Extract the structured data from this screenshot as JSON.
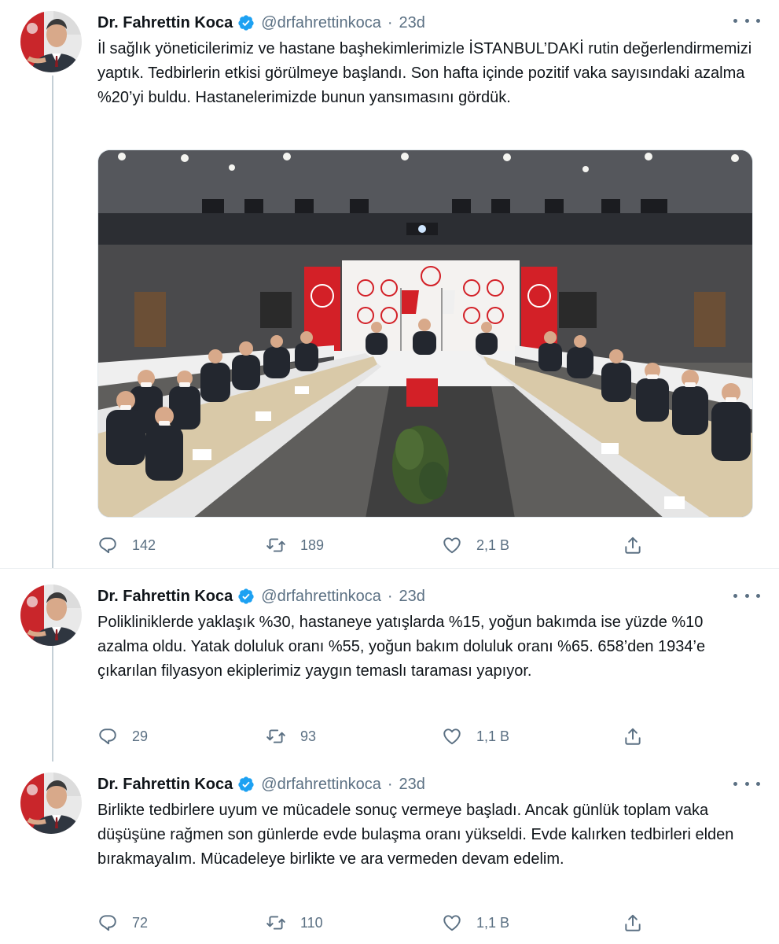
{
  "tweets": [
    {
      "name": "Dr. Fahrettin Koca",
      "handle": "@drfahrettinkoca",
      "separator": "·",
      "time": "23d",
      "text": "İl sağlık yöneticilerimiz ve hastane başhekimlerimizle İSTANBUL’DAKİ rutin değerlendirmemizi yaptık. Tedbirlerin etkisi görülmeye başlandı. Son hafta içinde pozitif vaka sayısındaki azalma %20’yi buldu. Hastanelerimizde bunun yansımasını gördük.",
      "replies": "142",
      "retweets": "189",
      "likes": "2,1 B"
    },
    {
      "name": "Dr. Fahrettin Koca",
      "handle": "@drfahrettinkoca",
      "separator": "·",
      "time": "23d",
      "text": "Polikliniklerde yaklaşık %30, hastaneye yatışlarda %15, yoğun bakımda ise yüzde %10 azalma oldu. Yatak doluluk oranı %55, yoğun bakım doluluk oranı %65. 658’den 1934’e çıkarılan filyasyon ekiplerimiz yaygın temaslı taraması yapıyor.",
      "replies": "29",
      "retweets": "93",
      "likes": "1,1 B"
    },
    {
      "name": "Dr. Fahrettin Koca",
      "handle": "@drfahrettinkoca",
      "separator": "·",
      "time": "23d",
      "text": "Birlikte tedbirlere uyum ve mücadele sonuç vermeye başladı. Ancak günlük toplam vaka düşüşüne rağmen son günlerde evde bulaşma oranı yükseldi. Evde kalırken tedbirleri elden bırakmayalım. Mücadeleye birlikte ve ara vermeden devam edelim.",
      "replies": "72",
      "retweets": "110",
      "likes": "1,1 B"
    }
  ],
  "icons": {
    "verified": "verified-badge-icon",
    "more": "more-options-icon",
    "reply": "reply-icon",
    "retweet": "retweet-icon",
    "like": "heart-icon",
    "share": "share-icon"
  },
  "colors": {
    "accent": "#1da1f2",
    "secondary_text": "#5b7083",
    "thread_line": "#c4cfd6",
    "ministry_red": "#d32027"
  }
}
